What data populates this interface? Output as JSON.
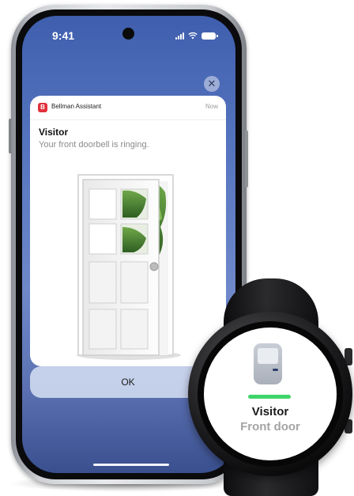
{
  "status_bar": {
    "time": "9:41"
  },
  "notification": {
    "app_icon_letter": "B",
    "app_name": "Bellman Assistant",
    "time": "Now",
    "title": "Visitor",
    "body": "Your front doorbell is ringing.",
    "dismiss_glyph": "✕",
    "image_icon": "open-door-illustration"
  },
  "action": {
    "ok_label": "OK"
  },
  "watch": {
    "icon": "door-icon",
    "title": "Visitor",
    "subtitle": "Front door",
    "accent_color": "#3fd56a"
  },
  "colors": {
    "brand_red": "#e0323c",
    "wallpaper": "#5b79c2"
  }
}
